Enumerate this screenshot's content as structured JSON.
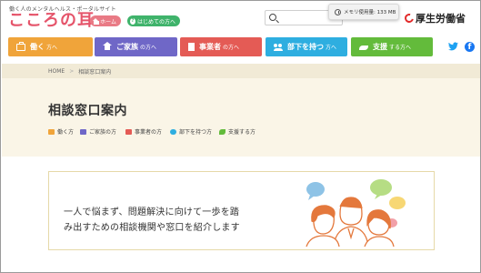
{
  "header": {
    "tagline": "働く人のメンタルヘルス・ポータルサイト",
    "logo": "こころの耳",
    "home_label": "ホーム",
    "first_time_label": "はじめての方へ",
    "first_time_icon": "?",
    "search_placeholder": "",
    "ministry": "厚生労働省"
  },
  "memory_tooltip": "メモリ使用量: 133 MB",
  "nav": [
    {
      "main": "働く",
      "suffix": "方へ",
      "icon": "briefcase-icon",
      "color": "#f0a43a"
    },
    {
      "main": "ご家族",
      "suffix": "の方へ",
      "icon": "house-icon",
      "color": "#6f67c7"
    },
    {
      "main": "事業者",
      "suffix": "の方へ",
      "icon": "building-icon",
      "color": "#e45b55"
    },
    {
      "main": "部下を持つ",
      "suffix": "方へ",
      "icon": "people-icon",
      "color": "#2eaee0"
    },
    {
      "main": "支援",
      "suffix": "する方へ",
      "icon": "hands-icon",
      "color": "#63bb3b"
    }
  ],
  "social": {
    "twitter": "🐦",
    "facebook": "f"
  },
  "breadcrumb": {
    "home": "HOME",
    "separator": ">",
    "current": "相談窓口案内"
  },
  "page": {
    "title": "相談窓口案内",
    "audiences": [
      "働く方",
      "ご家族の方",
      "事業者の方",
      "部下を持つ方",
      "支援する方"
    ]
  },
  "intro": {
    "line1": "一人で悩まず、問題解決に向けて一歩を踏",
    "line2": "み出すための相談機関や窓口を紹介します"
  }
}
